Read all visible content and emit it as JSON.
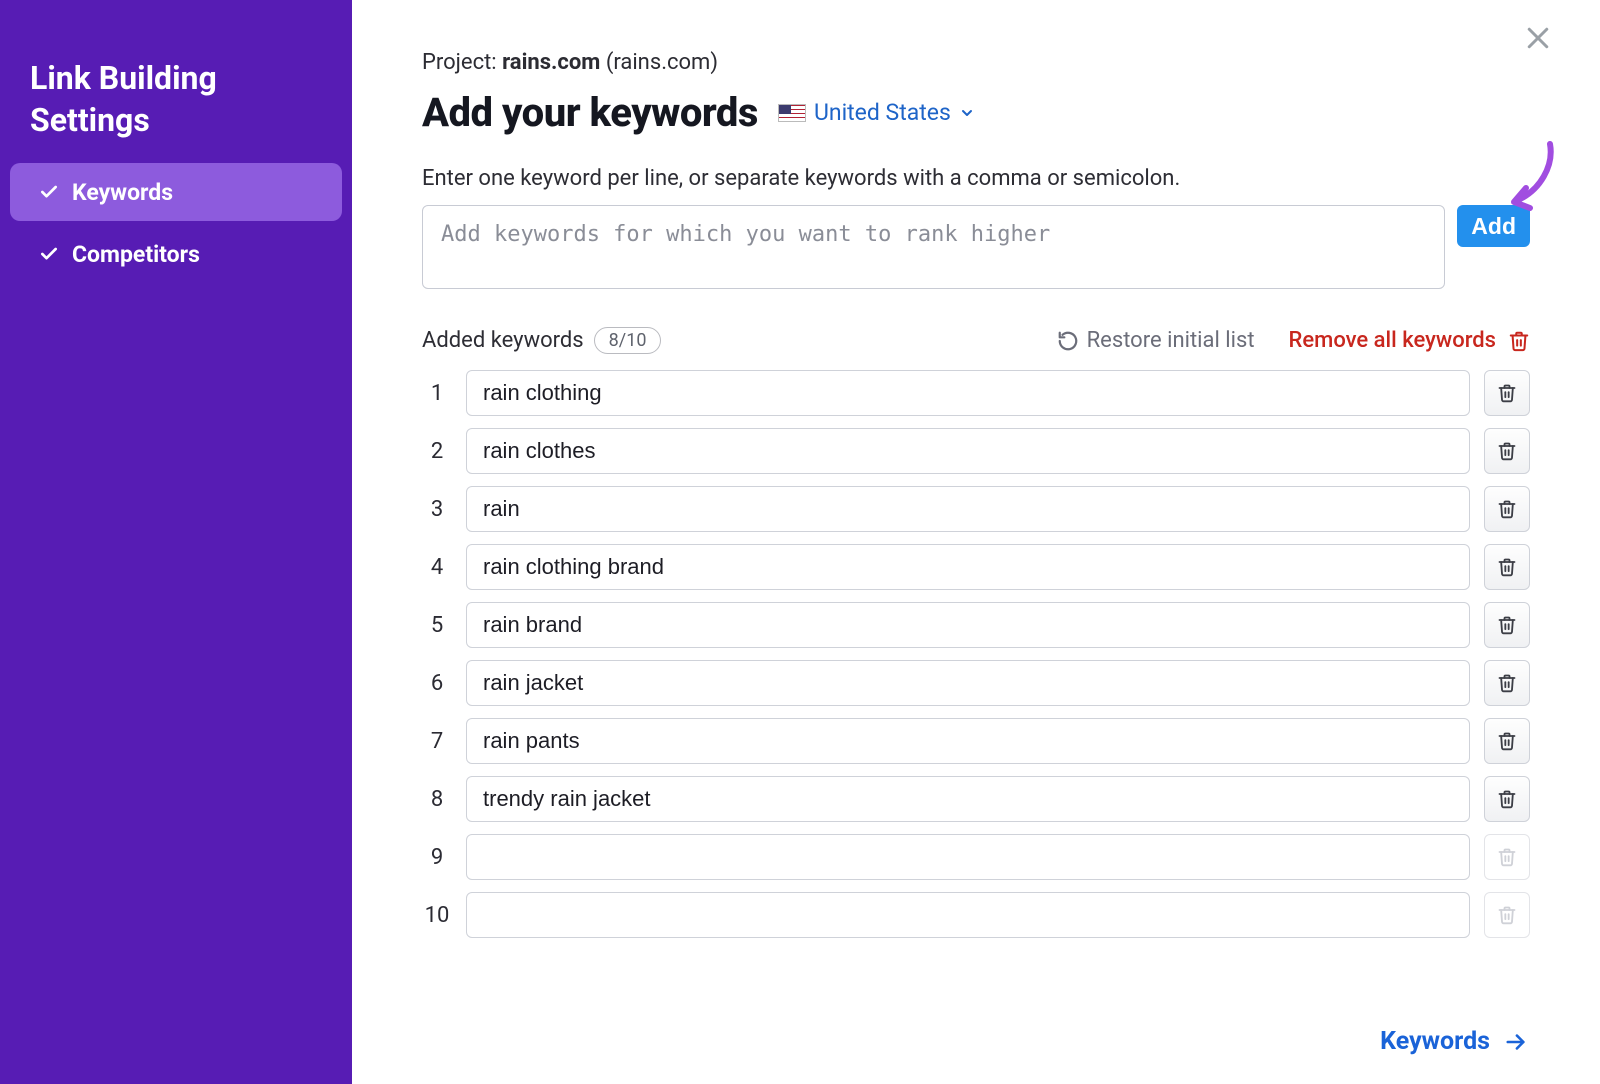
{
  "sidebar": {
    "title": "Link Building Settings",
    "items": [
      {
        "label": "Keywords",
        "active": true
      },
      {
        "label": "Competitors",
        "active": false
      }
    ]
  },
  "header": {
    "project_prefix": "Project: ",
    "project_name": "rains.com",
    "project_domain": "(rains.com)",
    "heading": "Add your keywords",
    "country": "United States"
  },
  "form": {
    "instructions": "Enter one keyword per line, or separate keywords with a comma or semicolon.",
    "textarea_placeholder": "Add keywords for which you want to rank higher",
    "add_button_label": "Add"
  },
  "added": {
    "label": "Added keywords",
    "count": "8/10",
    "restore_label": "Restore initial list",
    "remove_all_label": "Remove all keywords",
    "total_rows": 10,
    "keywords": [
      "rain clothing",
      "rain clothes",
      "rain",
      "rain clothing brand",
      "rain brand",
      "rain jacket",
      "rain pants",
      "trendy rain jacket"
    ]
  },
  "footer": {
    "next_label": "Keywords"
  },
  "colors": {
    "sidebar": "#571cb4",
    "sidebar_active": "#8d5bdd",
    "primary_blue": "#2390ed",
    "link_blue": "#1a63d8",
    "danger": "#c8271e",
    "callout": "#a14de0"
  }
}
